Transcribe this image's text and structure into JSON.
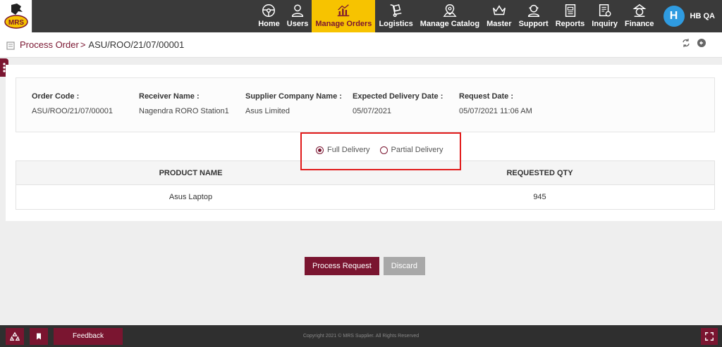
{
  "nav": {
    "items": [
      {
        "label": "Home",
        "icon": "steering-wheel-icon"
      },
      {
        "label": "Users",
        "icon": "user-icon"
      },
      {
        "label": "Manage Orders",
        "icon": "chart-icon",
        "active": true
      },
      {
        "label": "Logistics",
        "icon": "dolly-icon"
      },
      {
        "label": "Manage Catalog",
        "icon": "map-pin-icon"
      },
      {
        "label": "Master",
        "icon": "crown-icon"
      },
      {
        "label": "Support",
        "icon": "support-agent-icon"
      },
      {
        "label": "Reports",
        "icon": "report-icon"
      },
      {
        "label": "Inquiry",
        "icon": "inquiry-icon"
      },
      {
        "label": "Finance",
        "icon": "finance-icon"
      }
    ],
    "user": {
      "initial": "H",
      "name": "HB QA"
    }
  },
  "breadcrumb": {
    "parent": "Process Order",
    "separator": ">",
    "current": "ASU/ROO/21/07/00001"
  },
  "order_info": {
    "order_code": {
      "label": "Order Code :",
      "value": "ASU/ROO/21/07/00001"
    },
    "receiver_name": {
      "label": "Receiver Name :",
      "value": "Nagendra RORO Station1"
    },
    "supplier_company": {
      "label": "Supplier Company Name :",
      "value": "Asus Limited"
    },
    "expected_delivery": {
      "label": "Expected Delivery Date :",
      "value": "05/07/2021"
    },
    "request_date": {
      "label": "Request Date :",
      "value": "05/07/2021 11:06 AM"
    }
  },
  "delivery_options": {
    "full": "Full Delivery",
    "partial": "Partial Delivery",
    "selected": "full"
  },
  "table": {
    "headers": [
      "PRODUCT NAME",
      "REQUESTED QTY"
    ],
    "rows": [
      [
        "Asus Laptop",
        "945"
      ]
    ]
  },
  "actions": {
    "process": "Process Request",
    "discard": "Discard"
  },
  "footer": {
    "feedback": "Feedback",
    "copyright": "Copyright 2021 © MRS Supplier. All Rights Reserved"
  },
  "colors": {
    "brand": "#7a1530",
    "nav_bg": "#3a3a3a",
    "active_nav": "#f7c300",
    "highlight": "#e11a1a"
  }
}
